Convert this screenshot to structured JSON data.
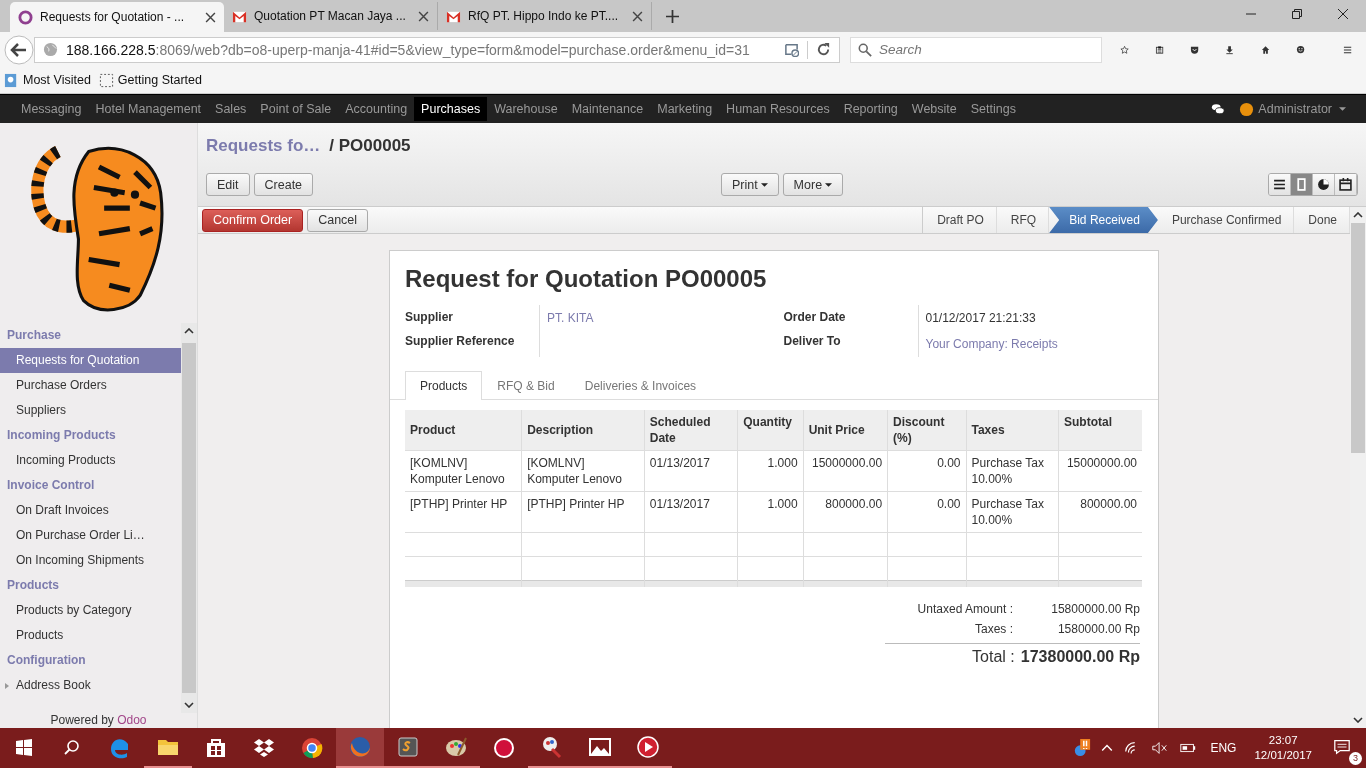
{
  "browser": {
    "tabs": [
      {
        "title": "Requests for Quotation - ...",
        "kind": "odoo",
        "selected": true
      },
      {
        "title": "Quotation PT Macan Jaya ...",
        "kind": "mail",
        "selected": false
      },
      {
        "title": "RfQ PT. Hippo Indo ke PT....",
        "kind": "mail",
        "selected": false
      }
    ],
    "url": {
      "host": "188.166.228.5",
      "rest": ":8069/web?db=o8-uperp-manja-41#id=5&view_type=form&model=purchase.order&menu_id=31"
    },
    "search": {
      "placeholder": "Search"
    },
    "bookmarks": [
      {
        "label": "Most Visited",
        "kind": "search"
      },
      {
        "label": "Getting Started",
        "kind": "blank"
      }
    ]
  },
  "menu": {
    "items": [
      {
        "label": "Messaging",
        "selected": false
      },
      {
        "label": "Hotel Management",
        "selected": false
      },
      {
        "label": "Sales",
        "selected": false
      },
      {
        "label": "Point of Sale",
        "selected": false
      },
      {
        "label": "Accounting",
        "selected": false
      },
      {
        "label": "Purchases",
        "selected": true
      },
      {
        "label": "Warehouse",
        "selected": false
      },
      {
        "label": "Maintenance",
        "selected": false
      },
      {
        "label": "Marketing",
        "selected": false
      },
      {
        "label": "Human Resources",
        "selected": false
      },
      {
        "label": "Reporting",
        "selected": false
      },
      {
        "label": "Website",
        "selected": false
      },
      {
        "label": "Settings",
        "selected": false
      }
    ],
    "user": "Administrator"
  },
  "sidebar": {
    "sections": [
      {
        "title": "Purchase",
        "items": [
          {
            "label": "Requests for Quotation",
            "selected": true,
            "expandable": false
          },
          {
            "label": "Purchase Orders",
            "selected": false,
            "expandable": false
          },
          {
            "label": "Suppliers",
            "selected": false,
            "expandable": false
          }
        ]
      },
      {
        "title": "Incoming Products",
        "items": [
          {
            "label": "Incoming Products",
            "selected": false,
            "expandable": false
          }
        ]
      },
      {
        "title": "Invoice Control",
        "items": [
          {
            "label": "On Draft Invoices",
            "selected": false,
            "expandable": false
          },
          {
            "label": "On Purchase Order Li…",
            "selected": false,
            "expandable": false
          },
          {
            "label": "On Incoming Shipments",
            "selected": false,
            "expandable": false
          }
        ]
      },
      {
        "title": "Products",
        "items": [
          {
            "label": "Products by Category",
            "selected": false,
            "expandable": false
          },
          {
            "label": "Products",
            "selected": false,
            "expandable": false
          }
        ]
      },
      {
        "title": "Configuration",
        "items": [
          {
            "label": "Address Book",
            "selected": false,
            "expandable": true
          }
        ]
      }
    ],
    "powered_by": {
      "text": "Powered by",
      "brand": "Odoo"
    }
  },
  "breadcrumb": {
    "parent": "Requests fo…",
    "separator": "/",
    "current": "PO00005"
  },
  "buttons": [
    {
      "label": "Edit"
    },
    {
      "label": "Create"
    }
  ],
  "dropdowns": [
    {
      "label": "Print"
    },
    {
      "label": "More"
    }
  ],
  "views": [
    {
      "kind": "list",
      "selected": false
    },
    {
      "kind": "form",
      "selected": true
    },
    {
      "kind": "graph",
      "selected": false
    },
    {
      "kind": "calendar",
      "selected": false
    }
  ],
  "actions": [
    {
      "label": "Confirm Order",
      "kind": "primary"
    },
    {
      "label": "Cancel",
      "kind": "default"
    }
  ],
  "stages": [
    {
      "label": "Draft PO",
      "selected": false
    },
    {
      "label": "RFQ",
      "selected": false
    },
    {
      "label": "Bid Received",
      "selected": true
    },
    {
      "label": "Purchase Confirmed",
      "selected": false
    },
    {
      "label": "Done",
      "selected": false
    }
  ],
  "form": {
    "title": "Request for Quotation",
    "number": "PO00005",
    "left_fields": [
      {
        "label": "Supplier",
        "value": "PT. KITA",
        "kind": "link"
      },
      {
        "label": "Supplier Reference",
        "kind": "text"
      }
    ],
    "right_fields": [
      {
        "label": "Order Date",
        "value": "01/12/2017 21:21:33",
        "kind": "text"
      },
      {
        "label": "Deliver To",
        "value": "Your Company: Receipts",
        "kind": "link"
      }
    ],
    "tabs": [
      {
        "label": "Products",
        "selected": true
      },
      {
        "label": "RFQ & Bid",
        "selected": false
      },
      {
        "label": "Deliveries & Invoices",
        "selected": false
      }
    ],
    "table": {
      "columns": [
        {
          "label": "Product",
          "kind": "text"
        },
        {
          "label": "Description",
          "kind": "text"
        },
        {
          "label": "Scheduled Date",
          "kind": "text"
        },
        {
          "label": "Quantity",
          "kind": "number"
        },
        {
          "label": "Unit Price",
          "kind": "number"
        },
        {
          "label": "Discount (%)",
          "kind": "number"
        },
        {
          "label": "Taxes",
          "kind": "text"
        },
        {
          "label": "Subtotal",
          "kind": "number"
        }
      ],
      "rows": [
        [
          "[KOMLNV] Komputer Lenovo",
          "[KOMLNV] Komputer Lenovo",
          "01/13/2017",
          "1.000",
          "15000000.00",
          "0.00",
          "Purchase Tax 10.00%",
          "15000000.00"
        ],
        [
          "[PTHP] Printer HP",
          "[PTHP] Printer HP",
          "01/13/2017",
          "1.000",
          "800000.00",
          "0.00",
          "Purchase Tax 10.00%",
          "800000.00"
        ]
      ]
    },
    "totals": [
      {
        "label": "Untaxed Amount :",
        "value": "15800000.00 Rp"
      },
      {
        "label": "Taxes :",
        "value": "1580000.00 Rp"
      }
    ],
    "total": {
      "label": "Total :",
      "value": "17380000.00 Rp"
    }
  },
  "taskbar": {
    "apps": [
      {
        "kind": "edge",
        "open": false,
        "active": false
      },
      {
        "kind": "folder",
        "open": true,
        "active": false
      },
      {
        "kind": "store",
        "open": false,
        "active": false
      },
      {
        "kind": "dropbox",
        "open": false,
        "active": false
      },
      {
        "kind": "chrome",
        "open": false,
        "active": false
      },
      {
        "kind": "firefox",
        "open": true,
        "active": true
      },
      {
        "kind": "terminal",
        "open": true,
        "active": false
      },
      {
        "kind": "palette",
        "open": true,
        "active": false
      },
      {
        "kind": "record",
        "open": false,
        "active": false
      },
      {
        "kind": "paint",
        "open": true,
        "active": false
      },
      {
        "kind": "photos",
        "open": true,
        "active": false
      },
      {
        "kind": "player",
        "open": true,
        "active": false
      }
    ],
    "language": "ENG",
    "time": "23:07",
    "date": "12/01/2017",
    "notifications": "3"
  }
}
